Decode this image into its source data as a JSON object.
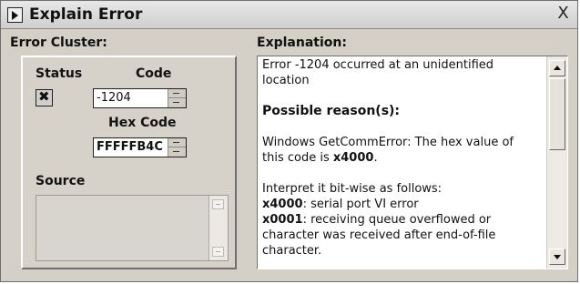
{
  "window": {
    "title": "Explain Error",
    "close_label": "X"
  },
  "error_cluster": {
    "title": "Error Cluster:",
    "status_label": "Status",
    "status_mark": "✖",
    "code_label": "Code",
    "code_value": "-1204",
    "hex_label": "Hex Code",
    "hex_value": "FFFFFB4C",
    "source_label": "Source",
    "source_value": ""
  },
  "explanation": {
    "title": "Explanation:",
    "line1": "Error -1204 occurred at an unidentified location",
    "reasons_heading": "Possible reason(s):",
    "windows_prefix": "Windows GetCommError:  The hex value of this code is ",
    "hex_bold": "x4000",
    "windows_suffix": ".",
    "interpret_text": "Interpret it bit-wise as follows:",
    "bit1_code": "x4000",
    "bit1_desc": ": serial port VI error",
    "bit2_code": "x0001",
    "bit2_desc": ": receiving queue overflowed or character was received after end-of-file character."
  }
}
